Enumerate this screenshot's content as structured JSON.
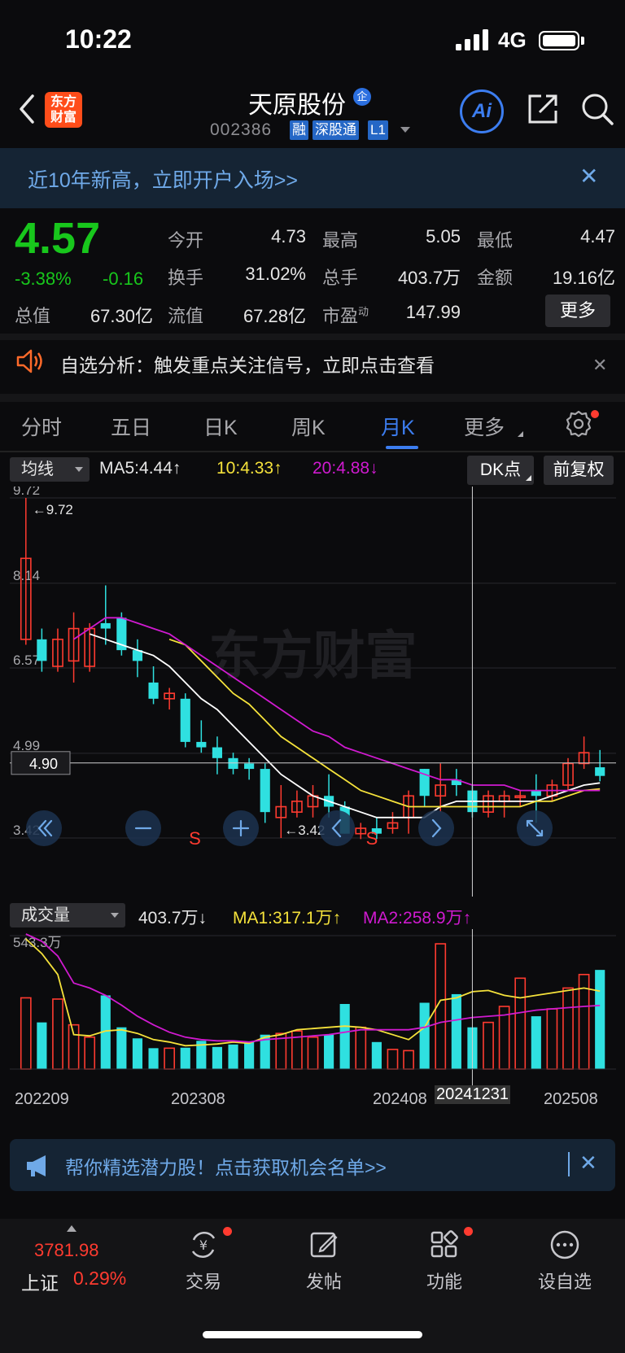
{
  "status": {
    "time": "10:22",
    "network": "4G"
  },
  "header": {
    "logo_line1": "东方",
    "logo_line2": "财富",
    "stock_name": "天原股份",
    "name_badge": "企",
    "stock_code": "002386",
    "tags": [
      "融",
      "深股通",
      "L1"
    ],
    "ai_label": "Ai"
  },
  "promo_banner": {
    "text": "近10年新高，立即开户入场>>"
  },
  "quote": {
    "price": "4.57",
    "change_pct": "-3.38%",
    "change_amt": "-0.16",
    "total_value_label": "总值",
    "total_value": "67.30亿",
    "fields": [
      {
        "label": "今开",
        "value": "4.73"
      },
      {
        "label": "最高",
        "value": "5.05"
      },
      {
        "label": "最低",
        "value": "4.47"
      },
      {
        "label": "换手",
        "value": "31.02%"
      },
      {
        "label": "总手",
        "value": "403.7万"
      },
      {
        "label": "金额",
        "value": "19.16亿"
      },
      {
        "label": "流值",
        "value": "67.28亿"
      },
      {
        "label": "市盈",
        "value": "147.99"
      }
    ],
    "pe_superscript": "动",
    "more_label": "更多"
  },
  "alert": {
    "text": "自选分析：触发重点关注信号，立即点击查看"
  },
  "tabs": [
    "分时",
    "五日",
    "日K",
    "周K",
    "月K",
    "更多"
  ],
  "active_tab": "月K",
  "ma_bar": {
    "select_label": "均线",
    "ma5": "MA5:4.44↑",
    "ma10": "10:4.33↑",
    "ma20": "20:4.88↓",
    "dk_label": "DK点",
    "fq_label": "前复权"
  },
  "volume_bar": {
    "select_label": "成交量",
    "vol": "403.7万↓",
    "ma1": "MA1:317.1万↑",
    "ma2": "MA2:258.9万↑"
  },
  "chart_data": [
    {
      "type": "candlestick",
      "y_ticks": [
        "9.72",
        "8.14",
        "6.57",
        "4.99",
        "3.42"
      ],
      "ylim": [
        3.42,
        9.72
      ],
      "max_label": "9.72",
      "min_label": "3.42",
      "crosshair_price": "4.90",
      "watermark": "东方财富",
      "signal_marks": [
        "S",
        "S"
      ],
      "candles": [
        {
          "o": 7.1,
          "h": 9.72,
          "l": 7.0,
          "c": 8.6
        },
        {
          "o": 7.1,
          "h": 7.3,
          "l": 6.5,
          "c": 6.7
        },
        {
          "o": 6.6,
          "h": 7.3,
          "l": 6.5,
          "c": 7.1
        },
        {
          "o": 6.7,
          "h": 7.6,
          "l": 6.3,
          "c": 7.3
        },
        {
          "o": 6.6,
          "h": 7.4,
          "l": 6.5,
          "c": 7.3
        },
        {
          "o": 7.4,
          "h": 8.1,
          "l": 7.0,
          "c": 7.3
        },
        {
          "o": 7.5,
          "h": 7.6,
          "l": 6.8,
          "c": 6.9
        },
        {
          "o": 6.9,
          "h": 7.1,
          "l": 6.4,
          "c": 6.7
        },
        {
          "o": 6.3,
          "h": 6.6,
          "l": 5.9,
          "c": 6.0
        },
        {
          "o": 6.0,
          "h": 6.2,
          "l": 5.8,
          "c": 6.1
        },
        {
          "o": 6.0,
          "h": 6.1,
          "l": 5.1,
          "c": 5.2
        },
        {
          "o": 5.2,
          "h": 5.6,
          "l": 5.0,
          "c": 5.1
        },
        {
          "o": 5.1,
          "h": 5.3,
          "l": 4.6,
          "c": 4.9
        },
        {
          "o": 4.9,
          "h": 5.0,
          "l": 4.6,
          "c": 4.7
        },
        {
          "o": 4.8,
          "h": 4.9,
          "l": 4.5,
          "c": 4.7
        },
        {
          "o": 4.7,
          "h": 4.8,
          "l": 3.7,
          "c": 3.9
        },
        {
          "o": 3.8,
          "h": 4.4,
          "l": 3.42,
          "c": 4.0
        },
        {
          "o": 3.9,
          "h": 4.3,
          "l": 3.8,
          "c": 4.1
        },
        {
          "o": 4.0,
          "h": 4.4,
          "l": 3.8,
          "c": 4.2
        },
        {
          "o": 4.2,
          "h": 4.6,
          "l": 3.8,
          "c": 4.0
        },
        {
          "o": 4.0,
          "h": 4.1,
          "l": 3.5,
          "c": 3.5
        },
        {
          "o": 3.5,
          "h": 3.7,
          "l": 3.4,
          "c": 3.6
        },
        {
          "o": 3.6,
          "h": 3.8,
          "l": 3.4,
          "c": 3.5
        },
        {
          "o": 3.6,
          "h": 3.9,
          "l": 3.5,
          "c": 3.7
        },
        {
          "o": 3.8,
          "h": 4.3,
          "l": 3.5,
          "c": 4.2
        },
        {
          "o": 4.7,
          "h": 4.7,
          "l": 4.0,
          "c": 4.2
        },
        {
          "o": 4.2,
          "h": 4.8,
          "l": 3.9,
          "c": 4.4
        },
        {
          "o": 4.5,
          "h": 4.7,
          "l": 4.2,
          "c": 4.4
        },
        {
          "o": 4.3,
          "h": 4.4,
          "l": 3.8,
          "c": 3.9
        },
        {
          "o": 3.9,
          "h": 4.3,
          "l": 3.8,
          "c": 4.2
        },
        {
          "o": 4.1,
          "h": 4.3,
          "l": 3.8,
          "c": 4.2
        },
        {
          "o": 4.2,
          "h": 4.3,
          "l": 4.0,
          "c": 4.2
        },
        {
          "o": 4.3,
          "h": 4.6,
          "l": 3.7,
          "c": 4.2
        },
        {
          "o": 4.2,
          "h": 4.5,
          "l": 4.1,
          "c": 4.4
        },
        {
          "o": 4.4,
          "h": 4.9,
          "l": 4.3,
          "c": 4.8
        },
        {
          "o": 4.8,
          "h": 5.3,
          "l": 4.7,
          "c": 5.0
        },
        {
          "o": 4.73,
          "h": 5.05,
          "l": 4.47,
          "c": 4.57
        }
      ],
      "ma_series": [
        {
          "name": "MA5",
          "color": "#ffffff",
          "values": [
            null,
            null,
            null,
            null,
            7.2,
            7.1,
            7.0,
            6.9,
            6.8,
            6.6,
            6.3,
            6.0,
            5.8,
            5.5,
            5.2,
            4.9,
            4.6,
            4.4,
            4.2,
            4.1,
            4.0,
            3.9,
            3.8,
            3.8,
            3.8,
            3.8,
            4.0,
            4.1,
            4.1,
            4.1,
            4.1,
            4.1,
            4.1,
            4.2,
            4.3,
            4.4,
            4.44
          ]
        },
        {
          "name": "MA10",
          "color": "#f5e23b",
          "values": [
            null,
            null,
            null,
            null,
            null,
            null,
            null,
            null,
            null,
            7.1,
            7.0,
            6.7,
            6.4,
            6.1,
            5.9,
            5.6,
            5.3,
            5.1,
            4.9,
            4.7,
            4.5,
            4.3,
            4.2,
            4.1,
            4.0,
            4.0,
            4.0,
            4.0,
            4.0,
            4.0,
            4.0,
            4.0,
            4.1,
            4.1,
            4.2,
            4.3,
            4.33
          ]
        },
        {
          "name": "MA20",
          "color": "#d01ad0",
          "values": [
            null,
            null,
            null,
            7.1,
            7.3,
            7.5,
            7.5,
            7.4,
            7.3,
            7.2,
            7.0,
            6.8,
            6.6,
            6.4,
            6.2,
            6.0,
            5.8,
            5.6,
            5.4,
            5.3,
            5.1,
            5.0,
            4.9,
            4.8,
            4.7,
            4.6,
            4.5,
            4.5,
            4.4,
            4.4,
            4.4,
            4.3,
            4.3,
            4.3,
            4.3,
            4.3,
            4.3
          ]
        }
      ]
    },
    {
      "type": "bar",
      "top_label": "543.3万",
      "ylim": [
        0,
        543.3
      ],
      "volumes": [
        290,
        190,
        285,
        180,
        130,
        300,
        170,
        125,
        85,
        85,
        87,
        115,
        90,
        100,
        110,
        140,
        145,
        155,
        130,
        140,
        265,
        170,
        110,
        80,
        75,
        270,
        510,
        305,
        170,
        190,
        255,
        370,
        215,
        245,
        330,
        385,
        403.7
      ],
      "ma_series": [
        {
          "name": "MA1",
          "color": "#f5e23b",
          "values": [
            530,
            470,
            385,
            140,
            135,
            155,
            160,
            145,
            120,
            110,
            95,
            98,
            102,
            110,
            105,
            130,
            140,
            160,
            165,
            170,
            175,
            170,
            160,
            140,
            120,
            170,
            280,
            290,
            315,
            320,
            300,
            290,
            300,
            310,
            320,
            330,
            317.1
          ]
        },
        {
          "name": "MA2",
          "color": "#d01ad0",
          "values": [
            550,
            520,
            460,
            350,
            330,
            300,
            260,
            215,
            180,
            150,
            130,
            120,
            115,
            115,
            110,
            120,
            125,
            130,
            135,
            140,
            150,
            160,
            160,
            160,
            160,
            170,
            190,
            200,
            210,
            215,
            220,
            230,
            240,
            245,
            250,
            255,
            258.9
          ]
        }
      ],
      "x_labels": [
        "202209",
        "202308",
        "202408",
        "202508"
      ],
      "crosshair_label": "20241231"
    }
  ],
  "promo_banner2": {
    "text": "帮你精选潜力股！点击获取机会名单>>"
  },
  "bottom_nav": {
    "index_value": "3781.98",
    "index_name": "上证",
    "index_pct": "0.29%",
    "items": [
      "交易",
      "发帖",
      "功能",
      "设自选"
    ]
  }
}
